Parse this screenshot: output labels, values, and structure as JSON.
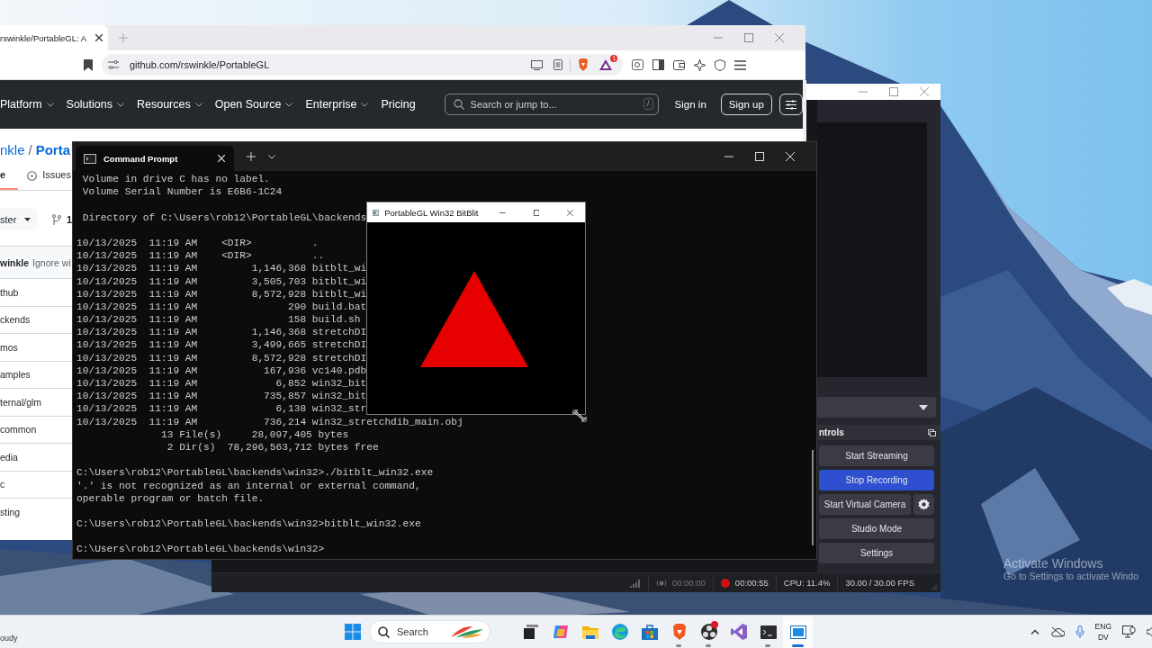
{
  "desktop": {
    "watermark": {
      "title": "Activate Windows",
      "subtitle": "Go to Settings to activate Windo"
    }
  },
  "browser": {
    "tab": {
      "title": "rswinkle/PortableGL: A"
    },
    "url": "github.com/rswinkle/PortableGL",
    "extension_badge": "1",
    "nav": [
      {
        "label": "Platform",
        "dropdown": true
      },
      {
        "label": "Solutions",
        "dropdown": true
      },
      {
        "label": "Resources",
        "dropdown": true
      },
      {
        "label": "Open Source",
        "dropdown": true
      },
      {
        "label": "Enterprise",
        "dropdown": true
      },
      {
        "label": "Pricing",
        "dropdown": false
      }
    ],
    "search": {
      "placeholder": "Search or jump to...",
      "shortcut": "/"
    },
    "sign_in": "Sign in",
    "sign_up": "Sign up",
    "repo": {
      "owner": "nkle",
      "separator": "/",
      "name": "Porta"
    },
    "repo_tabs": [
      {
        "label": "e",
        "selected": true
      },
      {
        "label": "Issues",
        "selected": false
      }
    ],
    "branch": "ster",
    "branch_count": "1",
    "commit": {
      "author": "winkle",
      "message": "Ignore wi"
    },
    "files": [
      "thub",
      "ckends",
      "mos",
      "amples",
      "ternal/glm",
      "common",
      "edia",
      "c",
      "sting"
    ]
  },
  "obs": {
    "dock_title": "ntrols",
    "buttons": [
      {
        "label": "Start Streaming",
        "active": false,
        "kind": "plain"
      },
      {
        "label": "Stop Recording",
        "active": true,
        "kind": "plain"
      },
      {
        "label": "Start Virtual Camera",
        "active": false,
        "kind": "with-settings"
      },
      {
        "label": "Studio Mode",
        "active": false,
        "kind": "plain"
      },
      {
        "label": "Settings",
        "active": false,
        "kind": "plain"
      }
    ],
    "status": {
      "stream_time": "00:00:00",
      "record_time": "00:00:55",
      "recording": true,
      "cpu": "CPU: 11.4%",
      "fps": "30.00 / 30.00 FPS"
    }
  },
  "cmd": {
    "title": "Command Prompt",
    "blocks": [
      [
        " Volume in drive C has no label.",
        " Volume Serial Number is E6B6-1C24"
      ],
      [
        " Directory of C:\\Users\\rob12\\PortableGL\\backends"
      ],
      [
        "10/13/2025  11:19 AM    <DIR>          .",
        "10/13/2025  11:19 AM    <DIR>          ..",
        "10/13/2025  11:19 AM         1,146,368 bitblt_wi",
        "10/13/2025  11:19 AM         3,505,703 bitblt_wi",
        "10/13/2025  11:19 AM         8,572,928 bitblt_wi",
        "10/13/2025  11:19 AM               290 build.bat",
        "10/13/2025  11:19 AM               158 build.sh",
        "10/13/2025  11:19 AM         1,146,368 stretchDI",
        "10/13/2025  11:19 AM         3,499,665 stretchDI",
        "10/13/2025  11:19 AM         8,572,928 stretchDI",
        "10/13/2025  11:19 AM           167,936 vc140.pdb",
        "10/13/2025  11:19 AM             6,852 win32_bit",
        "10/13/2025  11:19 AM           735,857 win32_bit",
        "10/13/2025  11:19 AM             6,138 win32_str",
        "10/13/2025  11:19 AM           736,214 win32_stretchdib_main.obj",
        "              13 File(s)     28,097,405 bytes",
        "               2 Dir(s)  78,296,563,712 bytes free"
      ],
      [
        "C:\\Users\\rob12\\PortableGL\\backends\\win32>./bitblt_win32.exe",
        "'.' is not recognized as an internal or external command,",
        "operable program or batch file."
      ],
      [
        "C:\\Users\\rob12\\PortableGL\\backends\\win32>bitblt_win32.exe"
      ],
      [
        "C:\\Users\\rob12\\PortableGL\\backends\\win32>"
      ]
    ]
  },
  "bitblit": {
    "title": "PortableGL Win32 BitBlit"
  },
  "taskbar": {
    "weather": "oudy",
    "search_placeholder": "Search",
    "apps": [
      {
        "kind": "task-view",
        "running": false,
        "selected": false,
        "alert": false
      },
      {
        "kind": "copilot",
        "running": false,
        "selected": false,
        "alert": false
      },
      {
        "kind": "folder",
        "running": false,
        "selected": false,
        "alert": false
      },
      {
        "kind": "edge",
        "running": false,
        "selected": false,
        "alert": false
      },
      {
        "kind": "store",
        "running": false,
        "selected": false,
        "alert": false
      },
      {
        "kind": "brave",
        "running": true,
        "selected": false,
        "alert": false
      },
      {
        "kind": "obs",
        "running": true,
        "selected": false,
        "alert": true
      },
      {
        "kind": "visual-studio",
        "running": false,
        "selected": false,
        "alert": false
      },
      {
        "kind": "terminal",
        "running": true,
        "selected": false,
        "alert": false
      },
      {
        "kind": "window",
        "running": true,
        "selected": true,
        "alert": false
      }
    ],
    "language": "ENG",
    "region": "DV"
  }
}
